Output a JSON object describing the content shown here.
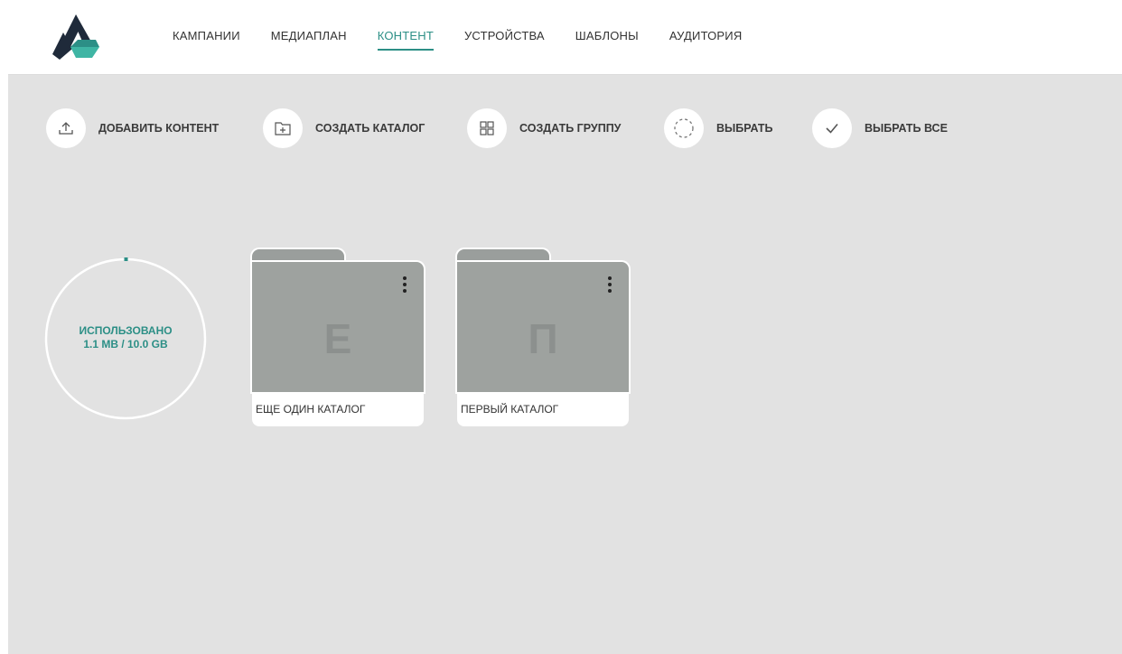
{
  "header": {
    "logo_icon": "app-logo",
    "nav": [
      {
        "label": "КАМПАНИИ",
        "active": false
      },
      {
        "label": "МЕДИАПЛАН",
        "active": false
      },
      {
        "label": "КОНТЕНТ",
        "active": true
      },
      {
        "label": "УСТРОЙСТВА",
        "active": false
      },
      {
        "label": "ШАБЛОНЫ",
        "active": false
      },
      {
        "label": "АУДИТОРИЯ",
        "active": false
      }
    ]
  },
  "toolbar": {
    "add_content": {
      "label": "ДОБАВИТЬ КОНТЕНТ",
      "icon": "upload-icon"
    },
    "create_catalog": {
      "label": "СОЗДАТЬ КАТАЛОГ",
      "icon": "add-folder-icon"
    },
    "create_group": {
      "label": "СОЗДАТЬ ГРУППУ",
      "icon": "grid-icon"
    },
    "select": {
      "label": "ВЫБРАТЬ",
      "icon": "dashed-circle-icon"
    },
    "select_all": {
      "label": "ВЫБРАТЬ ВСЕ",
      "icon": "checkmark-icon"
    }
  },
  "storage": {
    "label": "ИСПОЛЬЗОВАНО",
    "value": "1.1 MB / 10.0 GB",
    "used_fraction": 0.00011
  },
  "folders": [
    {
      "letter": "Е",
      "name": "ЕЩЕ ОДИН КАТАЛОГ"
    },
    {
      "letter": "П",
      "name": "ПЕРВЫЙ КАТАЛОГ"
    }
  ],
  "colors": {
    "accent": "#2c8f86",
    "background": "#e2e2e2",
    "folder": "#9ea29f"
  }
}
